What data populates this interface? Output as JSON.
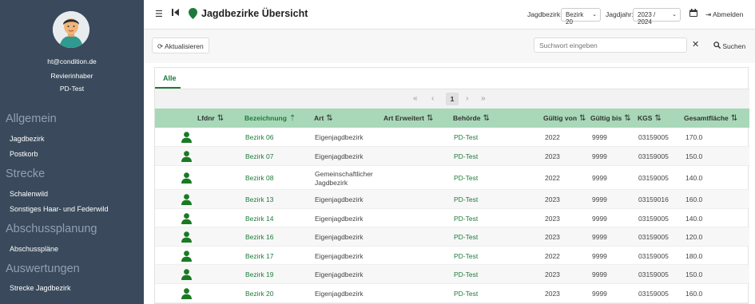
{
  "sidebar": {
    "email": "ht@condition.de",
    "role": "Revierinhaber",
    "org": "PD-Test",
    "sections": [
      {
        "title": "Allgemein",
        "items": [
          "Jagdbezirk",
          "Postkorb"
        ]
      },
      {
        "title": "Strecke",
        "items": [
          "Schalenwild",
          "Sonstiges Haar- und Federwild"
        ]
      },
      {
        "title": "Abschussplanung",
        "items": [
          "Abschusspläne"
        ]
      },
      {
        "title": "Auswertungen",
        "items": [
          "Strecke Jagdbezirk"
        ]
      }
    ]
  },
  "header": {
    "title": "Jagdbezirke Übersicht",
    "bezirk_label": "Jagdbezirk:",
    "bezirk_value": "Bezirk 20",
    "jahr_label": "Jagdjahr:",
    "jahr_value": "2023 / 2024",
    "logout_label": "Abmelden"
  },
  "toolbar": {
    "refresh_label": "Aktualisieren",
    "search_placeholder": "Suchwort eingeben",
    "search_label": "Suchen"
  },
  "tabs": [
    "Alle"
  ],
  "pagination": {
    "current": "1"
  },
  "table": {
    "columns": [
      "Lfdnr",
      "Bezeichnung",
      "Art",
      "Art Erweitert",
      "Behörde",
      "Gültig von",
      "Gültig bis",
      "KGS",
      "Gesamtfläche"
    ],
    "rows": [
      {
        "bez": "Bezirk 06",
        "art": "Eigenjagdbezirk",
        "art2": "",
        "beh": "PD-Test",
        "von": "2022",
        "bis": "9999",
        "kgs": "03159005",
        "fl": "170.0"
      },
      {
        "bez": "Bezirk 07",
        "art": "Eigenjagdbezirk",
        "art2": "",
        "beh": "PD-Test",
        "von": "2023",
        "bis": "9999",
        "kgs": "03159005",
        "fl": "150.0"
      },
      {
        "bez": "Bezirk 08",
        "art": "Gemeinschaftlicher",
        "art2": "Jagdbezirk",
        "beh": "PD-Test",
        "von": "2022",
        "bis": "9999",
        "kgs": "03159005",
        "fl": "140.0"
      },
      {
        "bez": "Bezirk 13",
        "art": "Eigenjagdbezirk",
        "art2": "",
        "beh": "PD-Test",
        "von": "2023",
        "bis": "9999",
        "kgs": "03159016",
        "fl": "160.0"
      },
      {
        "bez": "Bezirk 14",
        "art": "Eigenjagdbezirk",
        "art2": "",
        "beh": "PD-Test",
        "von": "2023",
        "bis": "9999",
        "kgs": "03159005",
        "fl": "140.0"
      },
      {
        "bez": "Bezirk 16",
        "art": "Eigenjagdbezirk",
        "art2": "",
        "beh": "PD-Test",
        "von": "2023",
        "bis": "9999",
        "kgs": "03159005",
        "fl": "120.0"
      },
      {
        "bez": "Bezirk 17",
        "art": "Eigenjagdbezirk",
        "art2": "",
        "beh": "PD-Test",
        "von": "2022",
        "bis": "9999",
        "kgs": "03159005",
        "fl": "180.0"
      },
      {
        "bez": "Bezirk 19",
        "art": "Eigenjagdbezirk",
        "art2": "",
        "beh": "PD-Test",
        "von": "2023",
        "bis": "9999",
        "kgs": "03159005",
        "fl": "150.0"
      },
      {
        "bez": "Bezirk 20",
        "art": "Eigenjagdbezirk",
        "art2": "",
        "beh": "PD-Test",
        "von": "2023",
        "bis": "9999",
        "kgs": "03159005",
        "fl": "160.0"
      }
    ]
  },
  "colors": {
    "accent": "#1e7a3c",
    "sidebar": "#3a4a5c",
    "header_row": "#a8d8b8"
  }
}
